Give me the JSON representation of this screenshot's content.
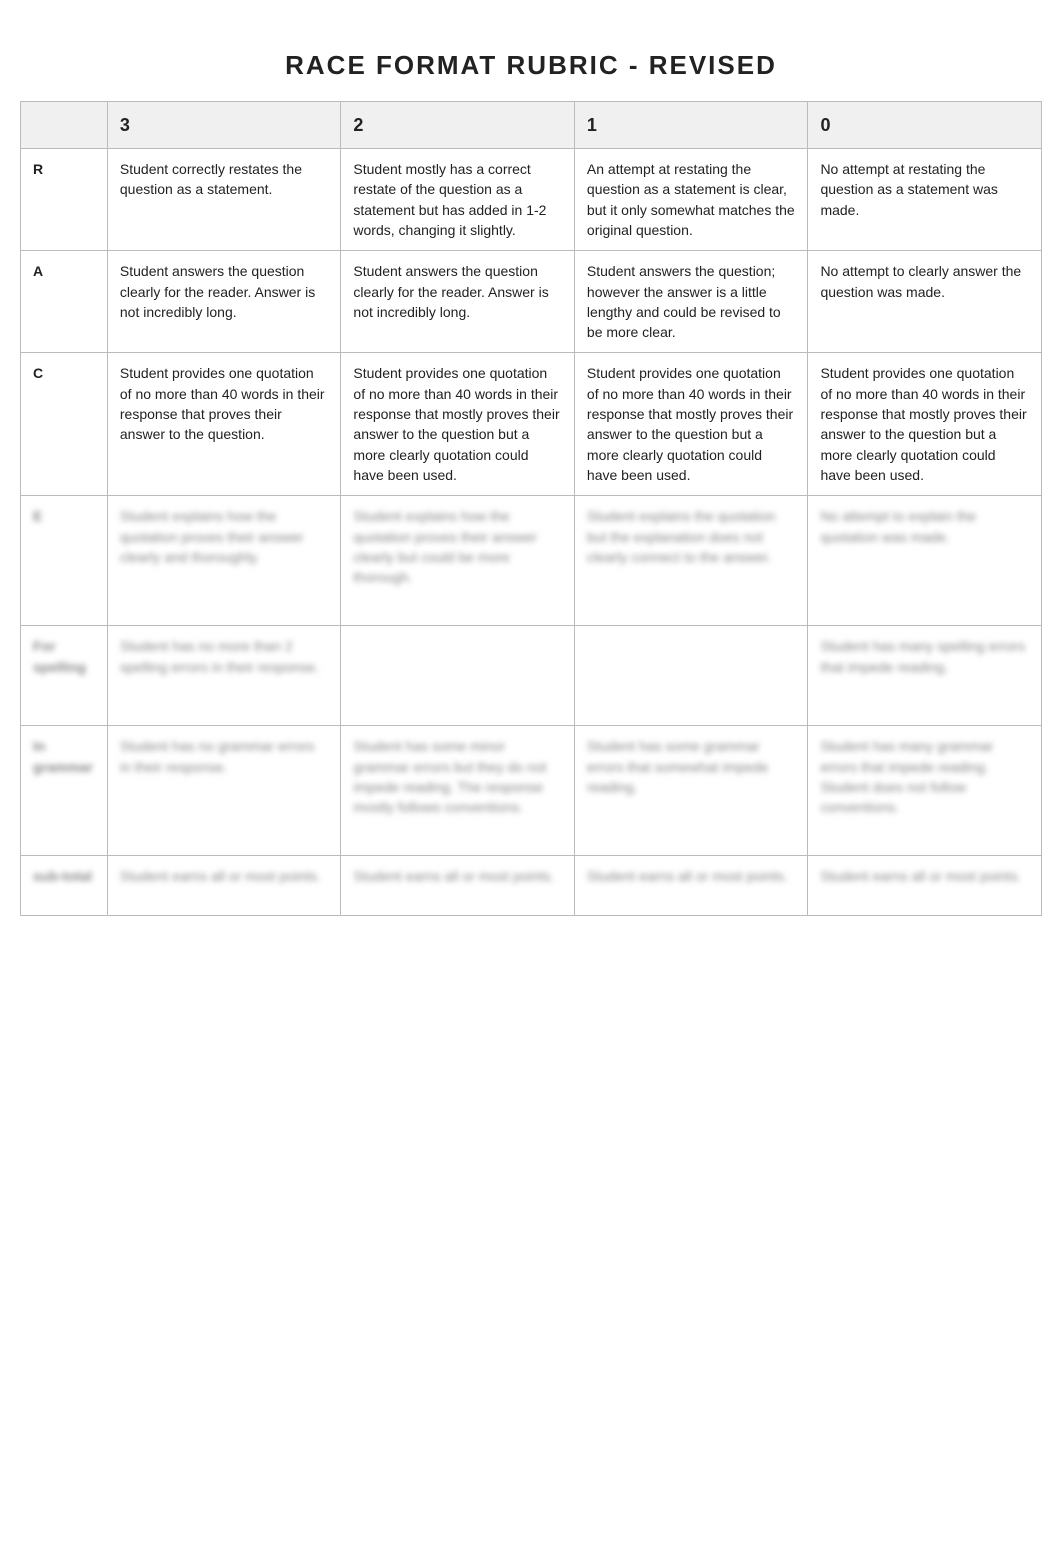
{
  "title": "RACE FORMAT RUBRIC - REVISED",
  "columns": {
    "score3": "3",
    "score2": "2",
    "score1": "1",
    "score0": "0"
  },
  "rows": [
    {
      "label": "R",
      "blurred": false,
      "cells": [
        "Student correctly restates the question as a statement.",
        "Student mostly has a correct restate of the question as a statement but has added in 1-2 words, changing it slightly.",
        "An attempt at restating the question as a statement is clear, but it only somewhat matches the original question.",
        "No attempt at restating the question as a statement was made."
      ]
    },
    {
      "label": "A",
      "blurred": false,
      "cells": [
        "Student answers the question clearly for the reader. Answer is not incredibly long.",
        "Student answers the question clearly for the reader. Answer is not incredibly long.",
        "Student answers the question; however the answer is a little lengthy and could be revised to be more clear.",
        "No attempt to clearly answer the question was made."
      ]
    },
    {
      "label": "C",
      "blurred": false,
      "cells": [
        "Student provides one quotation of no more than 40 words in their response that proves their answer to the question.",
        "Student provides one quotation of no more than 40 words in their response that mostly proves their answer to the question but a more clearly quotation could have been used.",
        "Student provides one quotation of no more than 40 words in their response that mostly proves their answer to the question but a more clearly quotation could have been used.",
        "Student provides one quotation of no more than 40 words in their response that mostly proves their answer to the question but a more clearly quotation could have been used."
      ]
    },
    {
      "label": "E",
      "blurred": true,
      "cells": [
        "Student explains how the quotation proves their answer clearly and thoroughly.",
        "Student explains how the quotation proves their answer clearly but could be more thorough.",
        "Student explains the quotation but the explanation does not clearly connect to the answer.",
        "No attempt to explain the quotation was made."
      ]
    },
    {
      "label": "For spelling",
      "blurred": true,
      "cells": [
        "Student has no more than 2 spelling errors in their response.",
        "",
        "",
        "Student has many spelling errors that impede reading."
      ]
    },
    {
      "label": "In grammar",
      "blurred": true,
      "cells": [
        "Student has no grammar errors in their response.",
        "Student has some minor grammar errors but they do not impede reading. The response mostly follows conventions.",
        "Student has some grammar errors that somewhat impede reading.",
        "Student has many grammar errors that impede reading. Student does not follow conventions."
      ]
    },
    {
      "label": "sub-total",
      "blurred": true,
      "cells": [
        "Student earns all or most points.",
        "Student earns all or most points.",
        "Student earns all or most points.",
        "Student earns all or most points."
      ]
    }
  ]
}
